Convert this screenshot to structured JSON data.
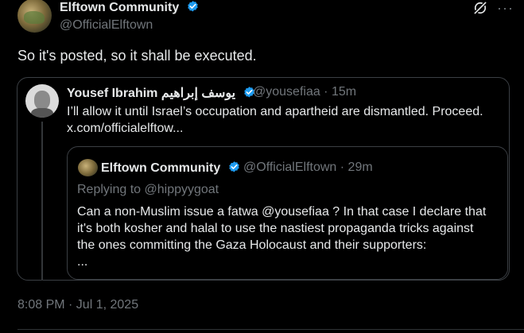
{
  "post": {
    "author_name": "Elftown Community",
    "author_handle": "@OfficialElftown",
    "text": "So it's posted, so it shall be executed.",
    "timestamp": "8:08 PM · Jul 1, 2025",
    "more_label": "···"
  },
  "quote": {
    "author_name": "Yousef Ibrahim يوسف إبراهيم",
    "meta": "@yousefiaa · 15m",
    "text_line1": "I’ll allow it until Israel’s occupation and apartheid are dismantled. Proceed.",
    "text_line2": "x.com/officialelftow...",
    "inner": {
      "author_name": "Elftown Community",
      "meta": "@OfficialElftown · 29m",
      "replying_to": "Replying to @hippyygoat",
      "text_line1": "Can a non-Muslim issue a fatwa @yousefiaa ? In that case I declare that",
      "text_line2": "it's both kosher and halal to use the nastiest propaganda tricks against",
      "text_line3": "the ones committing the Gaza Holocaust and their supporters:",
      "text_line4": "..."
    }
  },
  "colors": {
    "background": "#000000",
    "text": "#e7e9ea",
    "muted": "#71767b",
    "verified": "#1d9bf0",
    "border": "#3b3f44"
  },
  "icons": [
    "verified-badge-icon",
    "grok-icon",
    "more-icon"
  ]
}
